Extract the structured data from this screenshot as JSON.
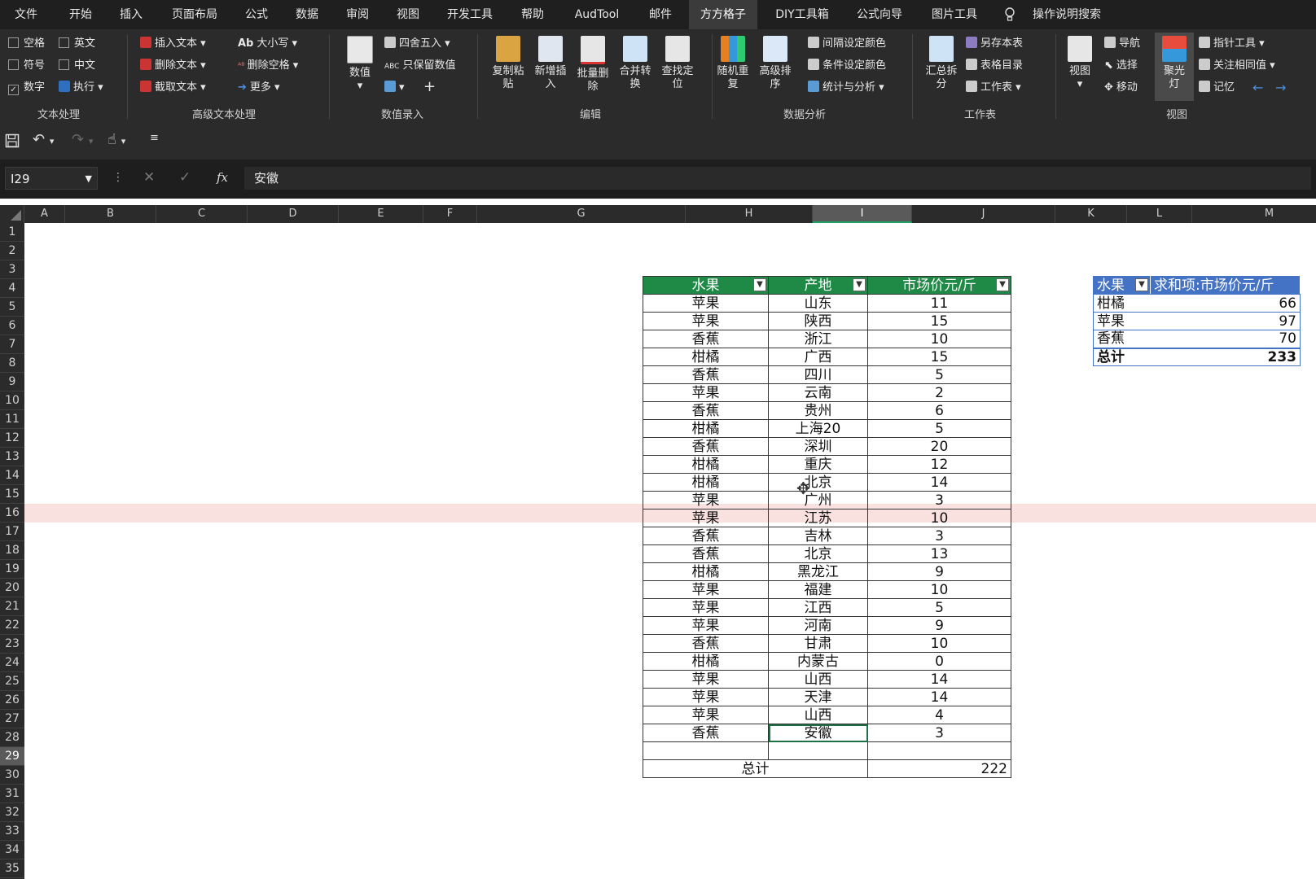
{
  "menu": [
    "文件",
    "开始",
    "插入",
    "页面布局",
    "公式",
    "数据",
    "审阅",
    "视图",
    "开发工具",
    "帮助",
    "AudTool",
    "邮件",
    "方方格子",
    "DIY工具箱",
    "公式向导",
    "图片工具",
    "操作说明搜索"
  ],
  "ribbon": {
    "text_group": {
      "kongge": "空格",
      "yingwen": "英文",
      "fuhao": "符号",
      "zhongwen": "中文",
      "shuzi": "数字",
      "zhixing": "执行",
      "label": "文本处理"
    },
    "adv_group": {
      "insert": "插入文本",
      "delete": "删除文本",
      "cut": "截取文本",
      "case": "大小写",
      "delspace": "删除空格",
      "more": "更多",
      "label": "高级文本处理"
    },
    "num_group": {
      "shuzhi": "数值",
      "round": "四舍五入",
      "keep": "只保留数值",
      "label": "数值录入"
    },
    "edit_group": {
      "b1a": "复制粘",
      "b1b": "贴",
      "b2a": "新增插",
      "b2b": "入",
      "b3a": "批量删",
      "b3b": "除",
      "b4a": "合并转",
      "b4b": "换",
      "b5a": "查找定",
      "b5b": "位",
      "label": "编辑"
    },
    "analysis_group": {
      "b1a": "随机重",
      "b1b": "复",
      "b2a": "高级排",
      "b2b": "序",
      "color1": "间隔设定颜色",
      "color2": "条件设定颜色",
      "stats": "统计与分析",
      "label": "数据分析"
    },
    "sheet_group": {
      "b1a": "汇总拆",
      "b1b": "分",
      "saveas": "另存本表",
      "catalog": "表格目录",
      "sheets": "工作表",
      "label": "工作表"
    },
    "view_group": {
      "view": "视图",
      "nav": "导航",
      "select": "选择",
      "move": "移动",
      "spot_a": "聚光",
      "spot_b": "灯",
      "pointer": "指针工具",
      "focus": "关注相同值",
      "memory": "记忆",
      "label": "视图"
    }
  },
  "formula_bar": {
    "name_box": "I29",
    "fx": "fx",
    "content": "安徽"
  },
  "columns": [
    "A",
    "B",
    "C",
    "D",
    "E",
    "F",
    "G",
    "H",
    "I",
    "J",
    "K",
    "L",
    "M"
  ],
  "rows": [
    "1",
    "2",
    "3",
    "4",
    "5",
    "6",
    "7",
    "8",
    "9",
    "10",
    "11",
    "12",
    "13",
    "14",
    "15",
    "16",
    "17",
    "18",
    "19",
    "20",
    "21",
    "22",
    "23",
    "24",
    "25",
    "26",
    "27",
    "28",
    "29",
    "30",
    "31",
    "32",
    "33",
    "34",
    "35"
  ],
  "table": {
    "headers": [
      "水果",
      "产地",
      "市场价元/斤"
    ],
    "rows": [
      [
        "苹果",
        "山东",
        "11"
      ],
      [
        "苹果",
        "陕西",
        "15"
      ],
      [
        "香蕉",
        "浙江",
        "10"
      ],
      [
        "柑橘",
        "广西",
        "15"
      ],
      [
        "香蕉",
        "四川",
        "5"
      ],
      [
        "苹果",
        "云南",
        "2"
      ],
      [
        "香蕉",
        "贵州",
        "6"
      ],
      [
        "柑橘",
        "上海20",
        "5"
      ],
      [
        "香蕉",
        "深圳",
        "20"
      ],
      [
        "柑橘",
        "重庆",
        "12"
      ],
      [
        "柑橘",
        "北京",
        "14"
      ],
      [
        "苹果",
        "广州",
        "3"
      ],
      [
        "苹果",
        "江苏",
        "10"
      ],
      [
        "香蕉",
        "吉林",
        "3"
      ],
      [
        "香蕉",
        "北京",
        "13"
      ],
      [
        "柑橘",
        "黑龙江",
        "9"
      ],
      [
        "苹果",
        "福建",
        "10"
      ],
      [
        "苹果",
        "江西",
        "5"
      ],
      [
        "苹果",
        "河南",
        "9"
      ],
      [
        "香蕉",
        "甘肃",
        "10"
      ],
      [
        "柑橘",
        "内蒙古",
        "0"
      ],
      [
        "苹果",
        "山西",
        "14"
      ],
      [
        "苹果",
        "天津",
        "14"
      ],
      [
        "苹果",
        "山西",
        "4"
      ],
      [
        "香蕉",
        "安徽",
        "3"
      ]
    ],
    "total_label": "总计",
    "total_value": "222"
  },
  "pivot": {
    "headers": [
      "水果",
      "求和项:市场价元/斤"
    ],
    "rows": [
      [
        "柑橘",
        "66"
      ],
      [
        "苹果",
        "97"
      ],
      [
        "香蕉",
        "70"
      ]
    ],
    "total_label": "总计",
    "total_value": "233"
  }
}
